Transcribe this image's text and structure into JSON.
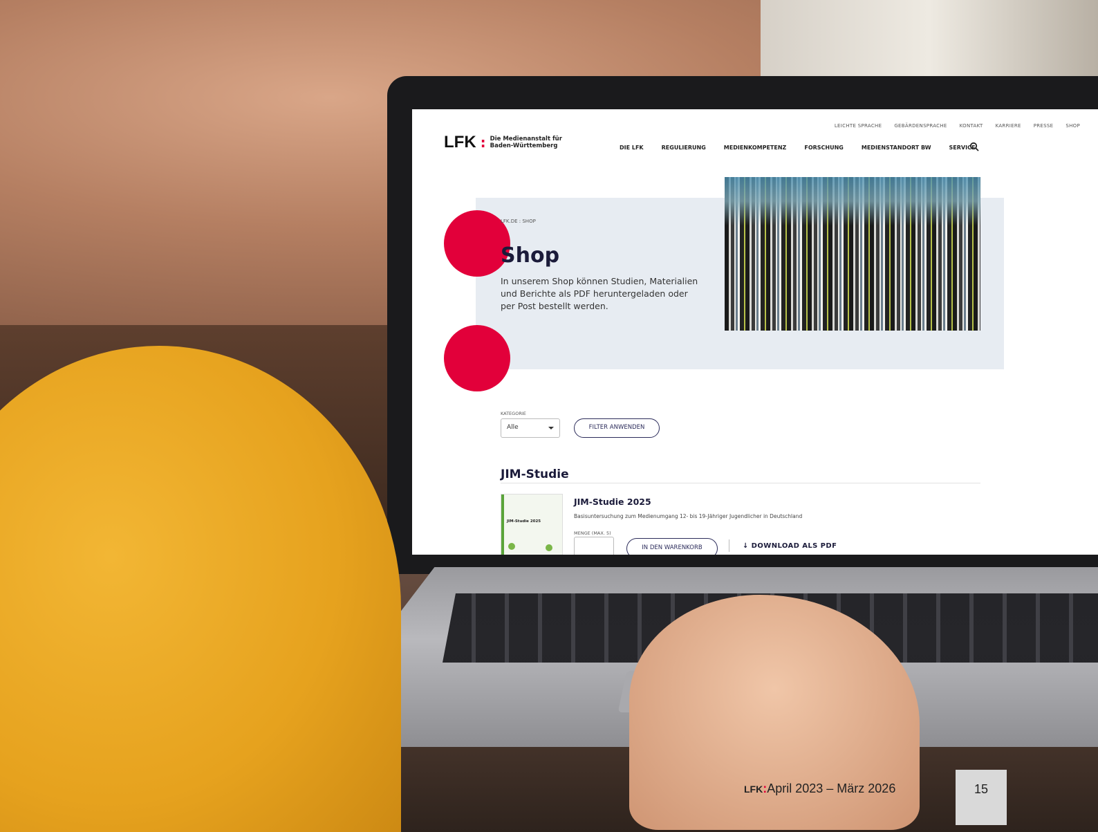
{
  "site": {
    "logo_mark": "LFK",
    "logo_dots": ":",
    "logo_line1": "Die Medienanstalt für",
    "logo_line2": "Baden-Württemberg",
    "top_nav": [
      "LEICHTE SPRACHE",
      "GEBÄRDENSPRACHE",
      "KONTAKT",
      "KARRIERE",
      "PRESSE",
      "SHOP"
    ],
    "main_nav": [
      "DIE LFK",
      "REGULIERUNG",
      "MEDIENKOMPETENZ",
      "FORSCHUNG",
      "MEDIENSTANDORT BW",
      "SERVICE"
    ]
  },
  "hero": {
    "breadcrumb": "LFK.DE  :  SHOP",
    "title": "Shop",
    "intro": "In unserem Shop können Studien, Materialien und Berichte als PDF heruntergeladen oder per Post bestellt werden."
  },
  "filter": {
    "label": "KATEGORIE",
    "selected": "Alle",
    "button": "FILTER ANWENDEN"
  },
  "section": {
    "title": "JIM-Studie",
    "product": {
      "thumb_title": "JIM-Studie 2025",
      "title": "JIM-Studie 2025",
      "description": "Basisuntersuchung zum Medienumgang 12- bis 19-Jähriger Jugendlicher in Deutschland",
      "qty_label": "MENGE (MAX. 5)",
      "cart_button": "IN DEN WARENKORB",
      "download_link": "DOWNLOAD ALS PDF"
    }
  },
  "footer": {
    "brand": "LFK",
    "colon": ":",
    "period": "April 2023 – März 2026",
    "page": "15"
  },
  "colors": {
    "accent": "#e2003a",
    "navy": "#1b1b3a"
  }
}
